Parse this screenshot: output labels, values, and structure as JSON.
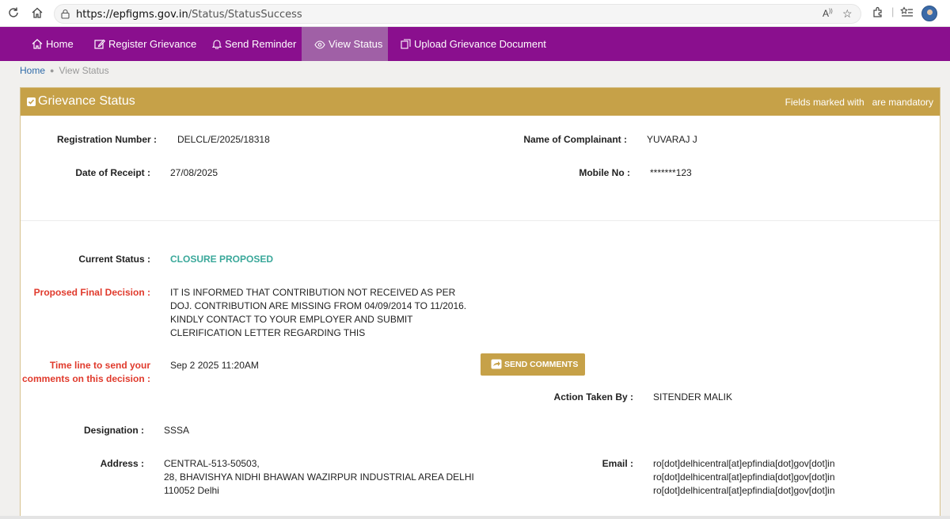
{
  "browser": {
    "url_host": "https://epfigms.gov.in",
    "url_path": "/Status/StatusSuccess",
    "read_aloud_label": "A̅",
    "icons": [
      "refresh-icon",
      "home-icon",
      "lock-icon",
      "read-aloud-icon",
      "favorite-star-icon",
      "extensions-icon",
      "favorites-list-icon",
      "profile-avatar"
    ]
  },
  "nav": {
    "items": [
      {
        "label": "Home",
        "icon": "home-icon"
      },
      {
        "label": "Register Grievance",
        "icon": "edit-icon"
      },
      {
        "label": "Send Reminder",
        "icon": "bell-icon"
      },
      {
        "label": "View Status",
        "icon": "eye-icon",
        "active": true
      },
      {
        "label": "Upload Grievance Document",
        "icon": "upload-doc-icon"
      }
    ],
    "bg_color": "#8a0f8e",
    "active_color": "#a060a6"
  },
  "breadcrumb": {
    "home": "Home",
    "current": "View Status"
  },
  "panel": {
    "title": "Grievance Status",
    "mandatory_prefix": "Fields marked with",
    "mandatory_suffix": "are mandatory",
    "header_color": "#c6a148"
  },
  "details": {
    "registration_number_label": "Registration Number :",
    "registration_number": "DELCL/E/2025/18318",
    "complainant_label": "Name of Complainant :",
    "complainant": "YUVARAJ J",
    "date_of_receipt_label": "Date of Receipt :",
    "date_of_receipt": "27/08/2025",
    "mobile_label": "Mobile No :",
    "mobile": "*******123",
    "current_status_label": "Current Status :",
    "current_status": "CLOSURE PROPOSED",
    "final_decision_label": "Proposed Final Decision :",
    "final_decision_lines": [
      "IT IS INFORMED THAT CONTRIBUTION NOT RECEIVED AS PER",
      "DOJ. CONTRIBUTION ARE MISSING FROM 04/09/2014 TO 11/2016.",
      "KINDLY CONTACT TO YOUR EMPLOYER AND SUBMIT",
      "CLERIFICATION LETTER REGARDING THIS"
    ],
    "timeline_label_line1": "Time line to send your",
    "timeline_label_line2": "comments on this decision :",
    "timeline": "Sep 2 2025 11:20AM",
    "send_comments_button": "SEND COMMENTS",
    "action_taken_label": "Action Taken By :",
    "action_taken": "SITENDER MALIK",
    "designation_label": "Designation :",
    "designation": "SSSA",
    "address_label": "Address :",
    "address_lines": [
      "CENTRAL-513-50503,",
      "28, BHAVISHYA NIDHI BHAWAN WAZIRPUR INDUSTRIAL AREA DELHI",
      "110052 Delhi"
    ],
    "email_label": "Email :",
    "email_lines": [
      "ro[dot]delhicentral[at]epfindia[dot]gov[dot]in",
      "ro[dot]delhicentral[at]epfindia[dot]gov[dot]in",
      "ro[dot]delhicentral[at]epfindia[dot]gov[dot]in"
    ],
    "status_color": "#3aa89a",
    "warning_color": "#e03a2c"
  }
}
